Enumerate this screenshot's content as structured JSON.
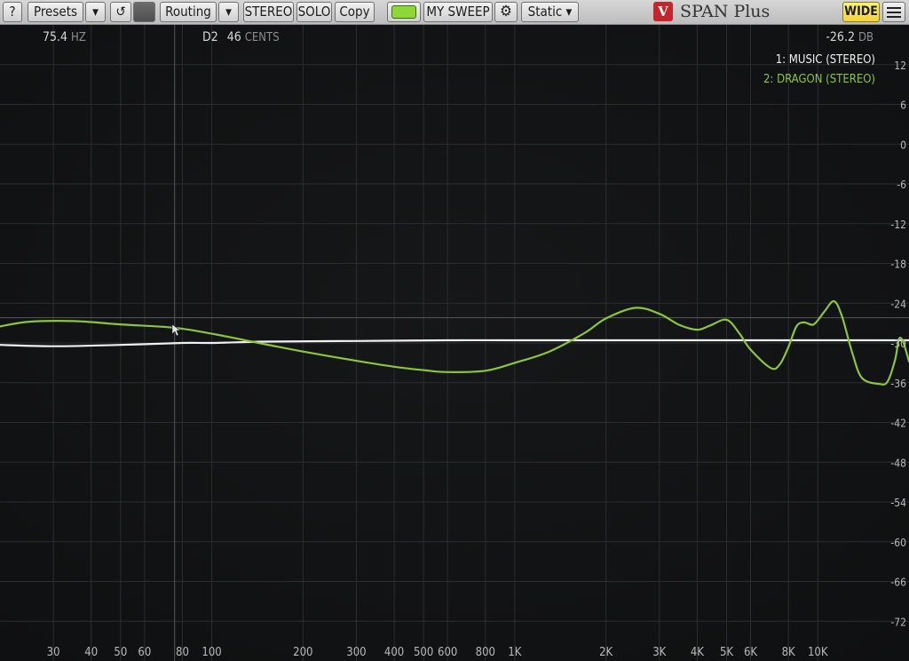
{
  "toolbar": {
    "help_label": "?",
    "presets_label": "Presets",
    "presets_arrow": "▾",
    "reset_glyph": "↺",
    "routing_label": "Routing",
    "routing_arrow": "▾",
    "stereo_label": "STEREO",
    "solo_label": "SOLO",
    "copy_label": "Copy",
    "sweep_label": "MY SWEEP",
    "settings_glyph": "⚙",
    "mode_label": "Static ▾",
    "brand_logo_text": "V",
    "brand_label": "SPAN Plus",
    "wide_label": "WIDE",
    "led_color": "#8fd63a"
  },
  "readouts": {
    "freq_value": "75.4",
    "freq_unit": "HZ",
    "note_value": "D2",
    "cents_value": "46",
    "cents_unit": "CENTS",
    "db_value": "-26.2",
    "db_unit": "DB"
  },
  "chart_data": {
    "type": "line",
    "xscale": "log",
    "xlim": [
      20,
      20000
    ],
    "ylim": [
      -78,
      18
    ],
    "x_ticks": [
      {
        "value": 30,
        "label": "30"
      },
      {
        "value": 40,
        "label": "40"
      },
      {
        "value": 50,
        "label": "50"
      },
      {
        "value": 60,
        "label": "60"
      },
      {
        "value": 80,
        "label": "80"
      },
      {
        "value": 100,
        "label": "100"
      },
      {
        "value": 200,
        "label": "200"
      },
      {
        "value": 300,
        "label": "300"
      },
      {
        "value": 400,
        "label": "400"
      },
      {
        "value": 500,
        "label": "500"
      },
      {
        "value": 600,
        "label": "600"
      },
      {
        "value": 800,
        "label": "800"
      },
      {
        "value": 1000,
        "label": "1K"
      },
      {
        "value": 2000,
        "label": "2K"
      },
      {
        "value": 3000,
        "label": "3K"
      },
      {
        "value": 4000,
        "label": "4K"
      },
      {
        "value": 5000,
        "label": "5K"
      },
      {
        "value": 6000,
        "label": "6K"
      },
      {
        "value": 8000,
        "label": "8K"
      },
      {
        "value": 10000,
        "label": "10K"
      }
    ],
    "y_ticks": [
      12,
      6,
      0,
      -6,
      -12,
      -18,
      -24,
      -30,
      -36,
      -42,
      -48,
      -54,
      -60,
      -66,
      -72
    ],
    "grid": true,
    "cursor": {
      "freq": 75.4,
      "db": -26.2
    },
    "legend_position": "top-right",
    "series": [
      {
        "name": "1: MUSIC (STEREO)",
        "color": "#f0f0f0",
        "points": [
          [
            20,
            -30.3
          ],
          [
            30,
            -30.5
          ],
          [
            50,
            -30.3
          ],
          [
            80,
            -30.0
          ],
          [
            100,
            -30.0
          ],
          [
            150,
            -29.8
          ],
          [
            300,
            -29.7
          ],
          [
            600,
            -29.6
          ],
          [
            1000,
            -29.6
          ],
          [
            3000,
            -29.6
          ],
          [
            10000,
            -29.6
          ],
          [
            20000,
            -29.6
          ]
        ]
      },
      {
        "name": "2: DRAGON (STEREO)",
        "color": "#8cc43c",
        "points": [
          [
            20,
            -27.5
          ],
          [
            25,
            -26.8
          ],
          [
            35,
            -26.7
          ],
          [
            50,
            -27.2
          ],
          [
            75,
            -27.7
          ],
          [
            100,
            -28.6
          ],
          [
            150,
            -30.2
          ],
          [
            200,
            -31.3
          ],
          [
            300,
            -32.7
          ],
          [
            400,
            -33.6
          ],
          [
            500,
            -34.1
          ],
          [
            600,
            -34.4
          ],
          [
            800,
            -34.2
          ],
          [
            1000,
            -33.0
          ],
          [
            1300,
            -31.3
          ],
          [
            1700,
            -28.5
          ],
          [
            2000,
            -26.3
          ],
          [
            2500,
            -24.7
          ],
          [
            3000,
            -25.6
          ],
          [
            3500,
            -27.3
          ],
          [
            4000,
            -28.0
          ],
          [
            4400,
            -27.4
          ],
          [
            5000,
            -26.5
          ],
          [
            5500,
            -28.5
          ],
          [
            6000,
            -31.0
          ],
          [
            7000,
            -33.8
          ],
          [
            7500,
            -33.2
          ],
          [
            8000,
            -30.6
          ],
          [
            8500,
            -27.5
          ],
          [
            9000,
            -26.9
          ],
          [
            9700,
            -27.2
          ],
          [
            10500,
            -25.3
          ],
          [
            11300,
            -23.7
          ],
          [
            12000,
            -25.9
          ],
          [
            13000,
            -31.5
          ],
          [
            14000,
            -35.3
          ],
          [
            16000,
            -36.2
          ],
          [
            17000,
            -35.8
          ],
          [
            18000,
            -32.5
          ],
          [
            18500,
            -29.5
          ],
          [
            19000,
            -29.5
          ],
          [
            19500,
            -31.0
          ],
          [
            20000,
            -32.8
          ]
        ]
      }
    ]
  }
}
